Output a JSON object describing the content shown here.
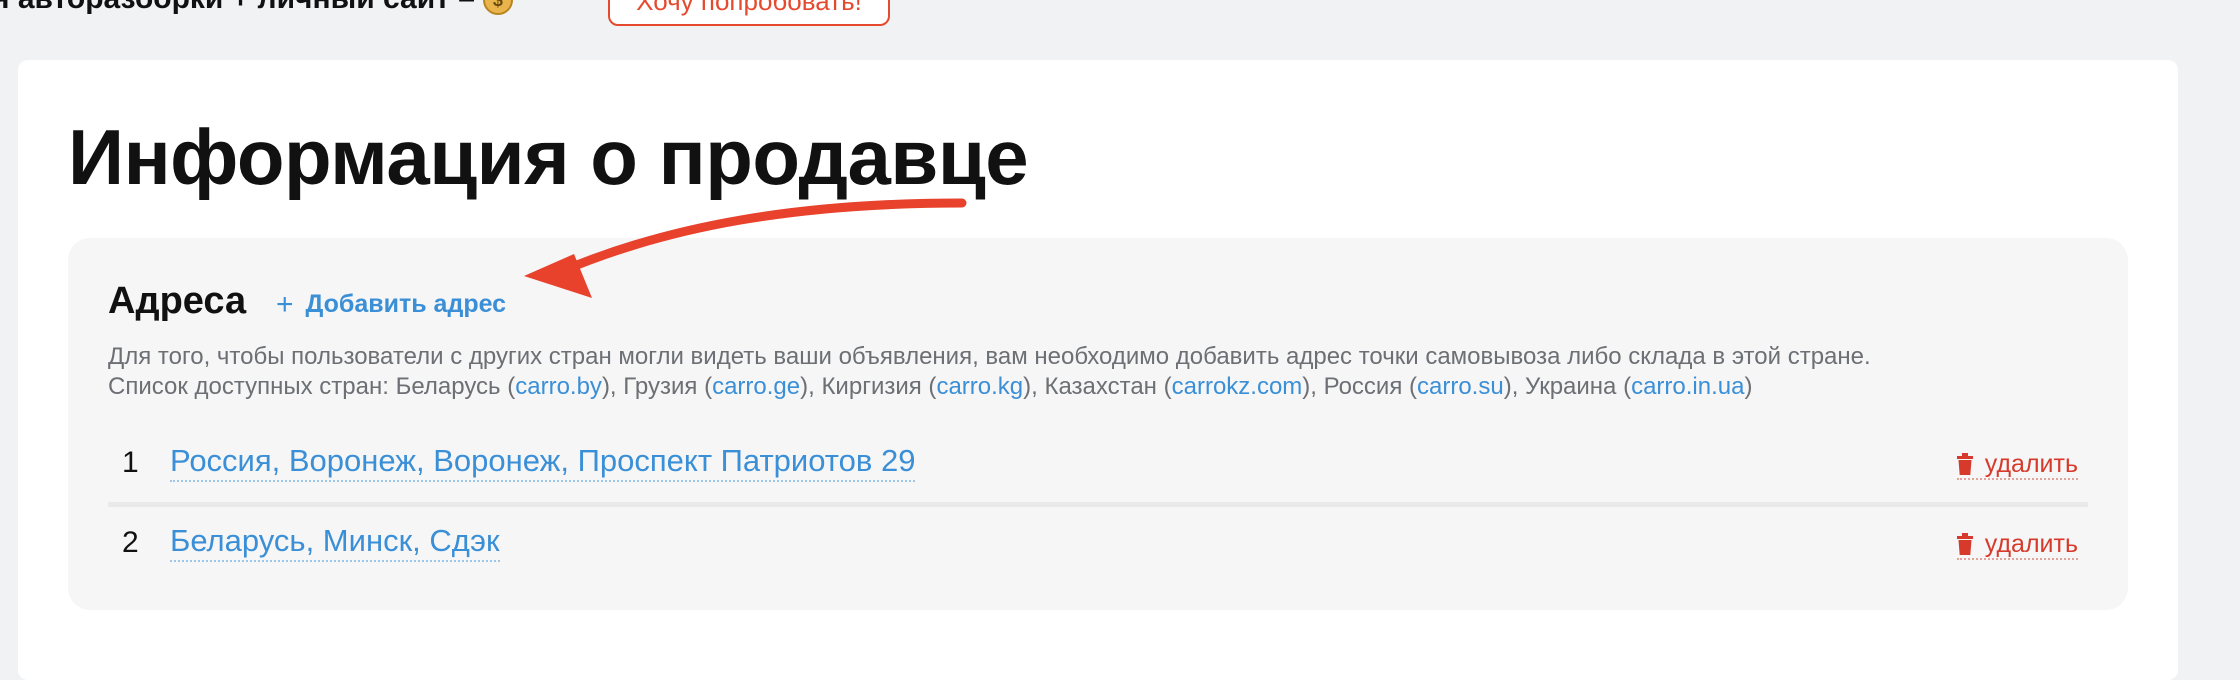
{
  "promo": {
    "text": "я авторазборки + личный сайт –",
    "coin_icon": "money-bag-icon",
    "button_label": "Хочу попробовать!"
  },
  "page": {
    "title": "Информация о продавце"
  },
  "addresses": {
    "title": "Адреса",
    "add_label": "Добавить адрес",
    "hint_line1": "Для того, чтобы пользователи с других стран могли видеть ваши объявления, вам необходимо добавить адрес точки самовывоза либо склада в этой стране.",
    "hint_prefix": "Список доступных стран:",
    "countries": [
      {
        "country": "Беларусь",
        "site": "carro.by"
      },
      {
        "country": "Грузия",
        "site": "carro.ge"
      },
      {
        "country": "Киргизия",
        "site": "carro.kg"
      },
      {
        "country": "Казахстан",
        "site": "carrokz.com"
      },
      {
        "country": "Россия",
        "site": "carro.su"
      },
      {
        "country": "Украина",
        "site": "carro.in.ua"
      }
    ],
    "items": [
      {
        "number": "1",
        "address": "Россия, Воронеж, Воронеж, Проспект Патриотов 29",
        "delete_label": "удалить"
      },
      {
        "number": "2",
        "address": "Беларусь, Минск, Сдэк",
        "delete_label": "удалить"
      }
    ]
  },
  "colors": {
    "accent": "#3a8fd6",
    "danger": "#d63a2a",
    "annotation_arrow": "#e8412c"
  }
}
